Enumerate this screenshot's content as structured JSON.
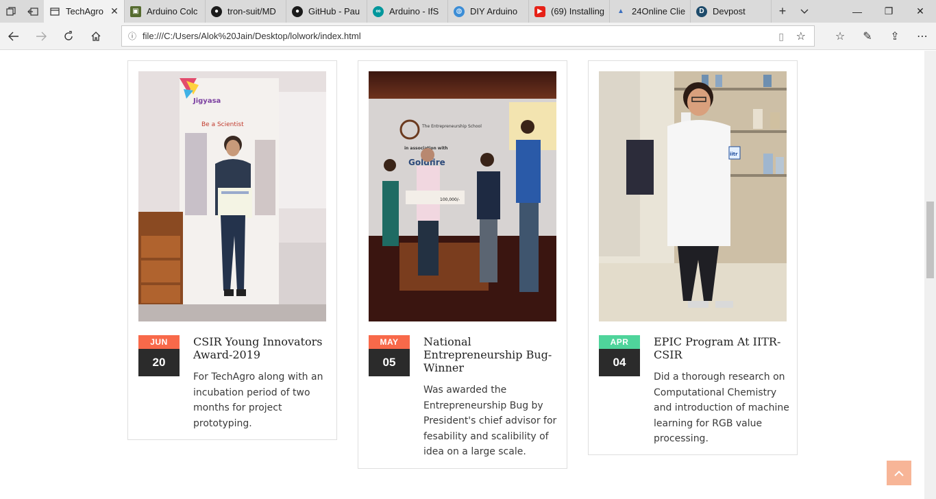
{
  "browser": {
    "tabs": [
      {
        "title": "TechAgro",
        "active": true
      },
      {
        "title": "Arduino Colc"
      },
      {
        "title": "tron-suit/MD"
      },
      {
        "title": "GitHub - Pau"
      },
      {
        "title": "Arduino - IfS"
      },
      {
        "title": "DIY Arduino"
      },
      {
        "title": "(69) Installing"
      },
      {
        "title": "24Online Clie"
      },
      {
        "title": "Devpost"
      }
    ],
    "url": "file:///C:/Users/Alok%20Jain/Desktop/lolwork/index.html"
  },
  "cards": [
    {
      "month": "JUN",
      "day": "20",
      "month_color": "#f8694a",
      "title": "CSIR Young Innovators Award-2019",
      "description": "For TechAgro along with an incubation period of two months for project prototyping."
    },
    {
      "month": "MAY",
      "day": "05",
      "month_color": "#f8694a",
      "title": "National Entrepreneurship Bug-Winner",
      "description": "Was awarded the Entrepreneurship Bug by President's chief advisor for fesability and scalibility of idea on a large scale."
    },
    {
      "month": "APR",
      "day": "04",
      "month_color": "#4fd49b",
      "title": "EPIC Program At IITR-CSIR",
      "description": "Did a thorough research on Computational Chemistry and introduction of machine learning for RGB value processing."
    }
  ],
  "photo1": {
    "banner_title": "Jigyasa",
    "banner_tagline": "Be a Scientist"
  },
  "photo2": {
    "banner_line1": "The Entrepreneurship School",
    "banner_line2": "in association with",
    "banner_line3": "Goldfire",
    "cheque_amount": "100,000/-"
  },
  "photo3": {
    "coat_logo": "iitr"
  }
}
